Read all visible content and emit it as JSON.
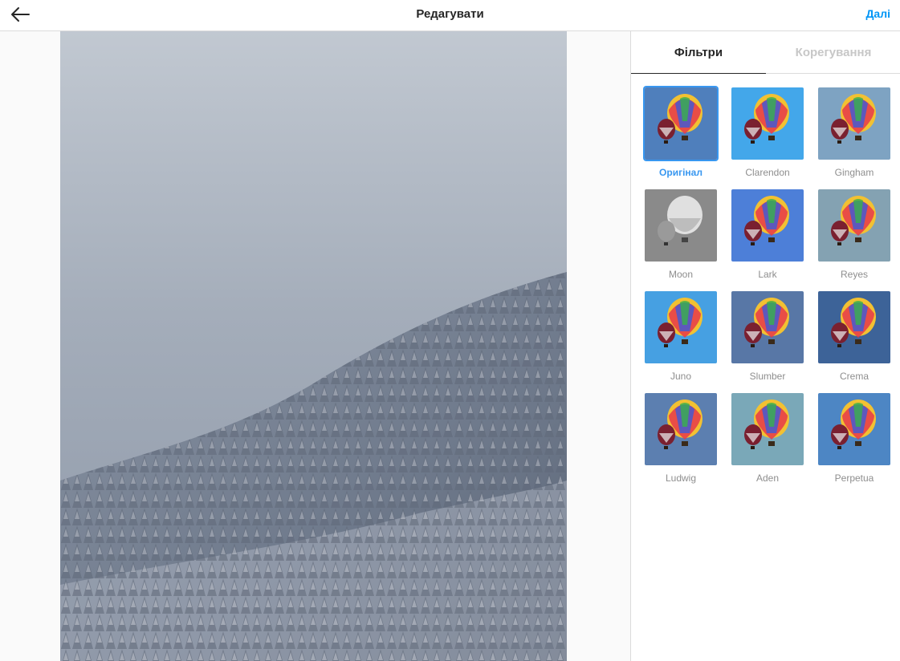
{
  "header": {
    "title": "Редагувати",
    "next_label": "Далі",
    "back_icon": "arrow-left-icon"
  },
  "photo": {
    "description_icon": "snowy-forest-photo"
  },
  "tabs": [
    {
      "label": "Фільтри",
      "active": true
    },
    {
      "label": "Корегування",
      "active": false
    }
  ],
  "filters": [
    {
      "label": "Оригінал",
      "selected": true,
      "bg": "#4f7fbc"
    },
    {
      "label": "Clarendon",
      "selected": false,
      "bg": "#43a7ea"
    },
    {
      "label": "Gingham",
      "selected": false,
      "bg": "#7ea3c2"
    },
    {
      "label": "Moon",
      "selected": false,
      "bg": "#8a8a8a"
    },
    {
      "label": "Lark",
      "selected": false,
      "bg": "#4d7fd8"
    },
    {
      "label": "Reyes",
      "selected": false,
      "bg": "#84a2b2"
    },
    {
      "label": "Juno",
      "selected": false,
      "bg": "#46a0e2"
    },
    {
      "label": "Slumber",
      "selected": false,
      "bg": "#5877a6"
    },
    {
      "label": "Crema",
      "selected": false,
      "bg": "#3d6398"
    },
    {
      "label": "Ludwig",
      "selected": false,
      "bg": "#5c7fb0"
    },
    {
      "label": "Aden",
      "selected": false,
      "bg": "#7aa8b8"
    },
    {
      "label": "Perpetua",
      "selected": false,
      "bg": "#4d86c4"
    }
  ],
  "colors": {
    "accent": "#0095f6",
    "selected": "#3897f0",
    "border": "#dbdbdb"
  }
}
